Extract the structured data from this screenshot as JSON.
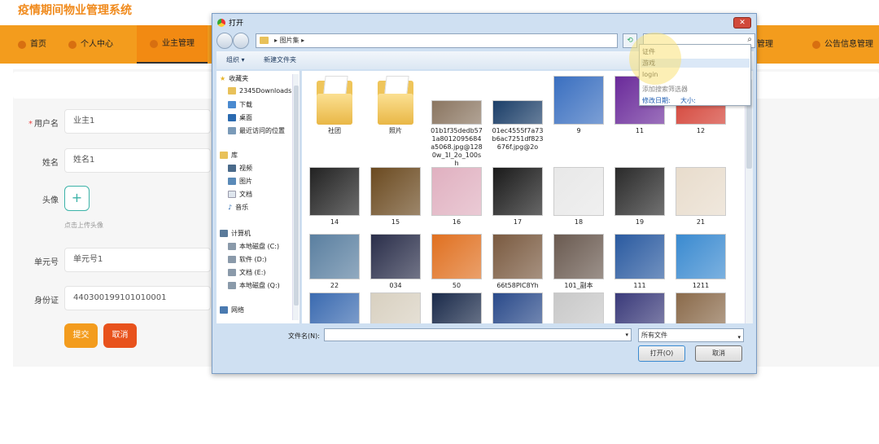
{
  "app": {
    "title": "疫情期间物业管理系统"
  },
  "nav": {
    "items": [
      "首页",
      "个人中心",
      "业主管理",
      "管理",
      "公告信息管理"
    ],
    "active": "业主管理"
  },
  "form": {
    "fields": [
      {
        "label": "用户名",
        "value": "业主1",
        "required": true
      },
      {
        "label": "姓名",
        "value": "姓名1",
        "required": false
      },
      {
        "label": "头像",
        "value": "",
        "required": false
      },
      {
        "label": "单元号",
        "value": "单元号1",
        "required": false
      },
      {
        "label": "身份证",
        "value": "440300199101010001",
        "required": false
      }
    ],
    "avatar_hint": "点击上传头像",
    "avatar_plus": "+",
    "submit_label": "提交",
    "cancel_label": "取消"
  },
  "dialog": {
    "title": "打开",
    "close": "✕",
    "path": "图片集",
    "organize": "组织 ▾",
    "new_folder": "新建文件夹",
    "nav_pane": {
      "favorites": "收藏夹",
      "fav_items": [
        "2345Downloads",
        "下载",
        "桌面",
        "最近访问的位置"
      ],
      "library": "库",
      "lib_items": [
        "视频",
        "图片",
        "文档",
        "音乐"
      ],
      "computer": "计算机",
      "drives": [
        "本地磁盘 (C:)",
        "软件 (D:)",
        "文档 (E:)",
        "本地磁盘 (Q:)"
      ],
      "network": "网络"
    },
    "files": [
      {
        "name": "社团",
        "kind": "folder"
      },
      {
        "name": "照片",
        "kind": "folder"
      },
      {
        "name": "01b1f35dedb571a8012095684a5068.jpg@1280w_1l_2o_100sh",
        "kind": "image",
        "color": "#8a7560"
      },
      {
        "name": "01ec4555f7a73b6ac7251df823676f.jpg@2o",
        "kind": "image",
        "color": "#1b3e68"
      },
      {
        "name": "9",
        "kind": "image",
        "color": "#3a6fc0"
      },
      {
        "name": "11",
        "kind": "image",
        "color": "#6a2a9a"
      },
      {
        "name": "12",
        "kind": "image",
        "color": "#d23a2e"
      },
      {
        "name": "14",
        "kind": "image",
        "color": "#222222"
      },
      {
        "name": "15",
        "kind": "image",
        "color": "#6b4a20"
      },
      {
        "name": "16",
        "kind": "image",
        "color": "#e0b0c0"
      },
      {
        "name": "17",
        "kind": "image",
        "color": "#1a1a1a"
      },
      {
        "name": "18",
        "kind": "image",
        "color": "#e8e8e8"
      },
      {
        "name": "19",
        "kind": "image",
        "color": "#2a2a2a"
      },
      {
        "name": "21",
        "kind": "image",
        "color": "#e8dccc"
      },
      {
        "name": "22",
        "kind": "image",
        "color": "#5a7fa0"
      },
      {
        "name": "034",
        "kind": "image",
        "color": "#2a2e4a"
      },
      {
        "name": "50",
        "kind": "image",
        "color": "#e07020"
      },
      {
        "name": "66t58PIC8Yh",
        "kind": "image",
        "color": "#7a5a40"
      },
      {
        "name": "101_副本",
        "kind": "image",
        "color": "#6a5a50"
      },
      {
        "name": "111",
        "kind": "image",
        "color": "#2a5aa0"
      },
      {
        "name": "1211",
        "kind": "image",
        "color": "#3a8ad0"
      },
      {
        "name": "",
        "kind": "image",
        "color": "#3a6ab0"
      },
      {
        "name": "",
        "kind": "image",
        "color": "#d8d0c0"
      },
      {
        "name": "",
        "kind": "image",
        "color": "#1a2a4a"
      },
      {
        "name": "",
        "kind": "image",
        "color": "#2a4a8a"
      },
      {
        "name": "",
        "kind": "image",
        "color": "#c8c8c8"
      },
      {
        "name": "",
        "kind": "image",
        "color": "#3a3a7a"
      },
      {
        "name": "",
        "kind": "image",
        "color": "#8a6a4a"
      }
    ],
    "filename_label": "文件名(N):",
    "filename_value": "",
    "filetype": "所有文件",
    "open_label": "打开(O)",
    "cancel_label": "取消"
  },
  "search_dropdown": {
    "items": [
      "证件",
      "游戏",
      "login"
    ],
    "add_filter": "添加搜索筛选器",
    "filters": [
      "修改日期:",
      "大小:"
    ]
  },
  "colors": {
    "accent": "#f39c1d",
    "title": "#f08a1c",
    "submit": "#f39c1d",
    "cancel": "#e8521c"
  }
}
